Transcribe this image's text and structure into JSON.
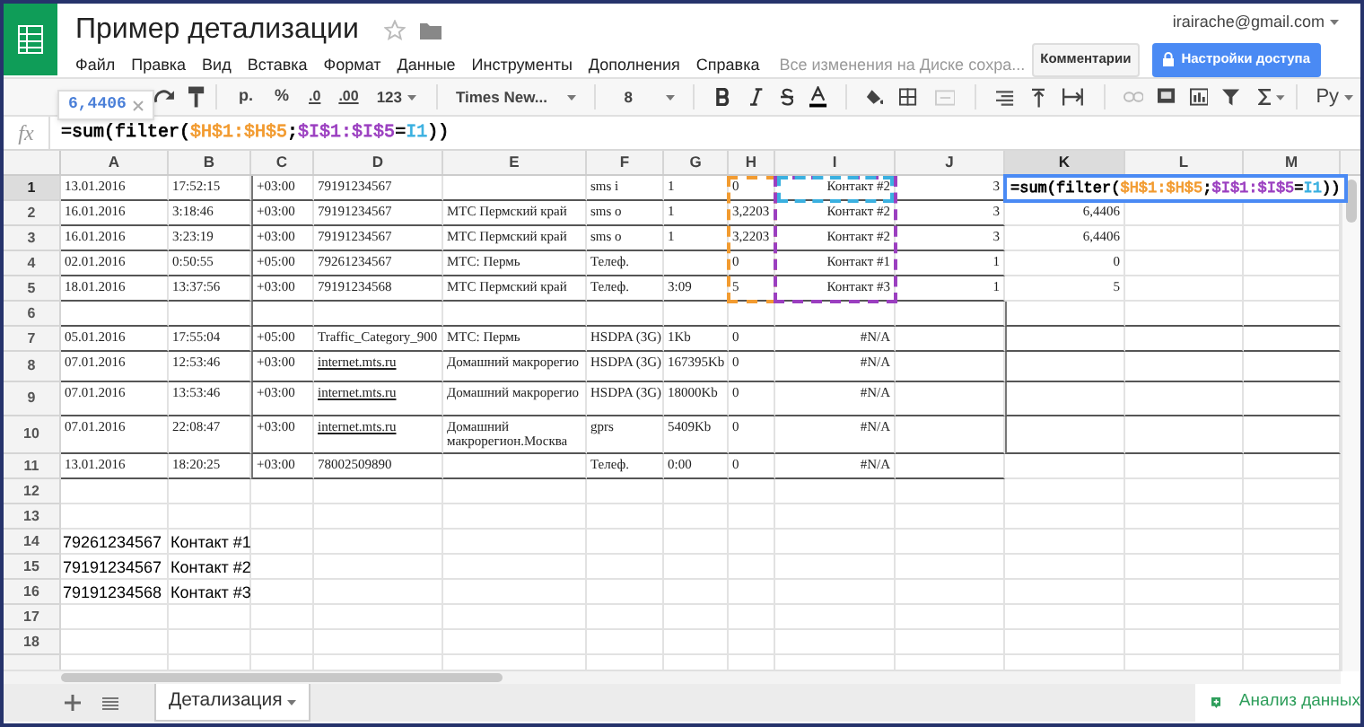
{
  "app": {
    "title": "Пример детализации",
    "account": "irairache@gmail.com",
    "save_status": "Все изменения на Диске сохра...",
    "comments_button": "Комментарии",
    "share_button": "Настройки доступа"
  },
  "menu": [
    "Файл",
    "Правка",
    "Вид",
    "Вставка",
    "Формат",
    "Данные",
    "Инструменты",
    "Дополнения",
    "Справка"
  ],
  "toolbar": {
    "currency": "р.",
    "percent": "%",
    "decrease_decimals": ".0",
    "increase_decimals": ".00",
    "number_formats": "123",
    "font": "Times New...",
    "font_size": "8",
    "input_language": "Ру"
  },
  "value_tooltip": "6,4406",
  "formula_bar": {
    "fx": "fx",
    "parts": [
      {
        "text": "=sum(filter(",
        "color": "#000000"
      },
      {
        "text": "$H$1:$H$5",
        "color": "#f29b30"
      },
      {
        "text": ";",
        "color": "#000000"
      },
      {
        "text": "$I$1:$I$5",
        "color": "#9b3fc0"
      },
      {
        "text": "=",
        "color": "#000000"
      },
      {
        "text": "I1",
        "color": "#3ab0e0"
      },
      {
        "text": "))",
        "color": "#000000"
      }
    ]
  },
  "columns": [
    {
      "label": "A",
      "selected": false
    },
    {
      "label": "B",
      "selected": false
    },
    {
      "label": "C",
      "selected": false
    },
    {
      "label": "D",
      "selected": false
    },
    {
      "label": "E",
      "selected": false
    },
    {
      "label": "F",
      "selected": false
    },
    {
      "label": "G",
      "selected": false
    },
    {
      "label": "H",
      "selected": false
    },
    {
      "label": "I",
      "selected": false
    },
    {
      "label": "J",
      "selected": false
    },
    {
      "label": "K",
      "selected": true
    },
    {
      "label": "L",
      "selected": false
    },
    {
      "label": "M",
      "selected": false
    }
  ],
  "rows": [
    {
      "number": "1",
      "selected": true,
      "kind": "record",
      "cells": [
        "13.01.2016",
        "17:52:15",
        "+03:00",
        "79191234567",
        null,
        "sms i",
        "1",
        "0",
        "Контакт #2",
        "3"
      ]
    },
    {
      "number": "2",
      "selected": false,
      "kind": "record",
      "cells": [
        "16.01.2016",
        "3:18:46",
        "+03:00",
        "79191234567",
        "МТС Пермский край",
        "sms o",
        "1",
        "3,2203",
        "Контакт #2",
        "3",
        "6,4406"
      ]
    },
    {
      "number": "3",
      "selected": false,
      "kind": "record",
      "cells": [
        "16.01.2016",
        "3:23:19",
        "+03:00",
        "79191234567",
        "МТС Пермский край",
        "sms o",
        "1",
        "3,2203",
        "Контакт #2",
        "3",
        "6,4406"
      ]
    },
    {
      "number": "4",
      "selected": false,
      "kind": "record",
      "cells": [
        "02.01.2016",
        "0:50:55",
        "+05:00",
        "79261234567",
        "МТС: Пермь",
        "Телеф.",
        null,
        "0",
        "Контакт #1",
        "1",
        "0"
      ]
    },
    {
      "number": "5",
      "selected": false,
      "kind": "record",
      "cells": [
        "18.01.2016",
        "13:37:56",
        "+03:00",
        "79191234568",
        "МТС Пермский край",
        "Телеф.",
        "3:09",
        "5",
        "Контакт #3",
        "1",
        "5"
      ]
    },
    {
      "number": "6",
      "selected": false,
      "kind": "record",
      "cells": []
    },
    {
      "number": "7",
      "selected": false,
      "kind": "record",
      "cells": [
        "05.01.2016",
        "17:55:04",
        "+05:00",
        "Traffic_Category_900",
        "МТС: Пермь",
        "HSDPA (3G)",
        "1Kb",
        "0",
        "#N/A"
      ]
    },
    {
      "number": "8",
      "selected": false,
      "kind": "record",
      "cells": [
        "07.01.2016",
        "12:53:46",
        "+03:00",
        {
          "text": "internet.mts.ru",
          "kind": "link"
        },
        "Домашний макрорегио",
        "HSDPA (3G)",
        "167395Kb",
        "0",
        "#N/A"
      ]
    },
    {
      "number": "9",
      "selected": false,
      "kind": "record",
      "cells": [
        "07.01.2016",
        "13:53:46",
        "+03:00",
        {
          "text": "internet.mts.ru",
          "kind": "link"
        },
        "Домашний макрорегио",
        "HSDPA (3G)",
        "18000Kb",
        "0",
        "#N/A"
      ]
    },
    {
      "number": "10",
      "selected": false,
      "kind": "record",
      "cells": [
        "07.01.2016",
        "22:08:47",
        "+03:00",
        {
          "text": "internet.mts.ru",
          "kind": "link"
        },
        "Домашний макрорегион.Москва",
        "gprs",
        "5409Kb",
        "0",
        "#N/A"
      ]
    },
    {
      "number": "11",
      "selected": false,
      "kind": "record",
      "cells": [
        "13.01.2016",
        "18:20:25",
        "+03:00",
        "78002509890",
        null,
        "Телеф.",
        "0:00",
        "0",
        "#N/A"
      ]
    },
    {
      "number": "12",
      "selected": false,
      "kind": "plain",
      "cells": []
    },
    {
      "number": "13",
      "selected": false,
      "kind": "plain",
      "cells": []
    },
    {
      "number": "14",
      "selected": false,
      "kind": "plain",
      "cells": [
        "79261234567",
        "Контакт #1"
      ]
    },
    {
      "number": "15",
      "selected": false,
      "kind": "plain",
      "cells": [
        "79191234567",
        "Контакт #2"
      ]
    },
    {
      "number": "16",
      "selected": false,
      "kind": "plain",
      "cells": [
        "79191234568",
        "Контакт #3"
      ]
    },
    {
      "number": "17",
      "selected": false,
      "kind": "plain",
      "cells": []
    },
    {
      "number": "18",
      "selected": false,
      "kind": "plain",
      "cells": []
    }
  ],
  "cell_editor": {
    "parts": [
      {
        "text": "=sum(filter(",
        "color": "#000000"
      },
      {
        "text": "$H$1:$H$5",
        "color": "#f29b30"
      },
      {
        "text": ";",
        "color": "#000000"
      },
      {
        "text": "$I$1:$I$5",
        "color": "#9b3fc0"
      },
      {
        "text": "=",
        "color": "#000000"
      },
      {
        "text": "I1",
        "color": "#3ab0e0"
      },
      {
        "text": "))",
        "color": "#000000"
      }
    ]
  },
  "sheet_tabs": [
    {
      "label": "Детализация",
      "selected": true
    }
  ],
  "explore_button": "Анализ данных"
}
